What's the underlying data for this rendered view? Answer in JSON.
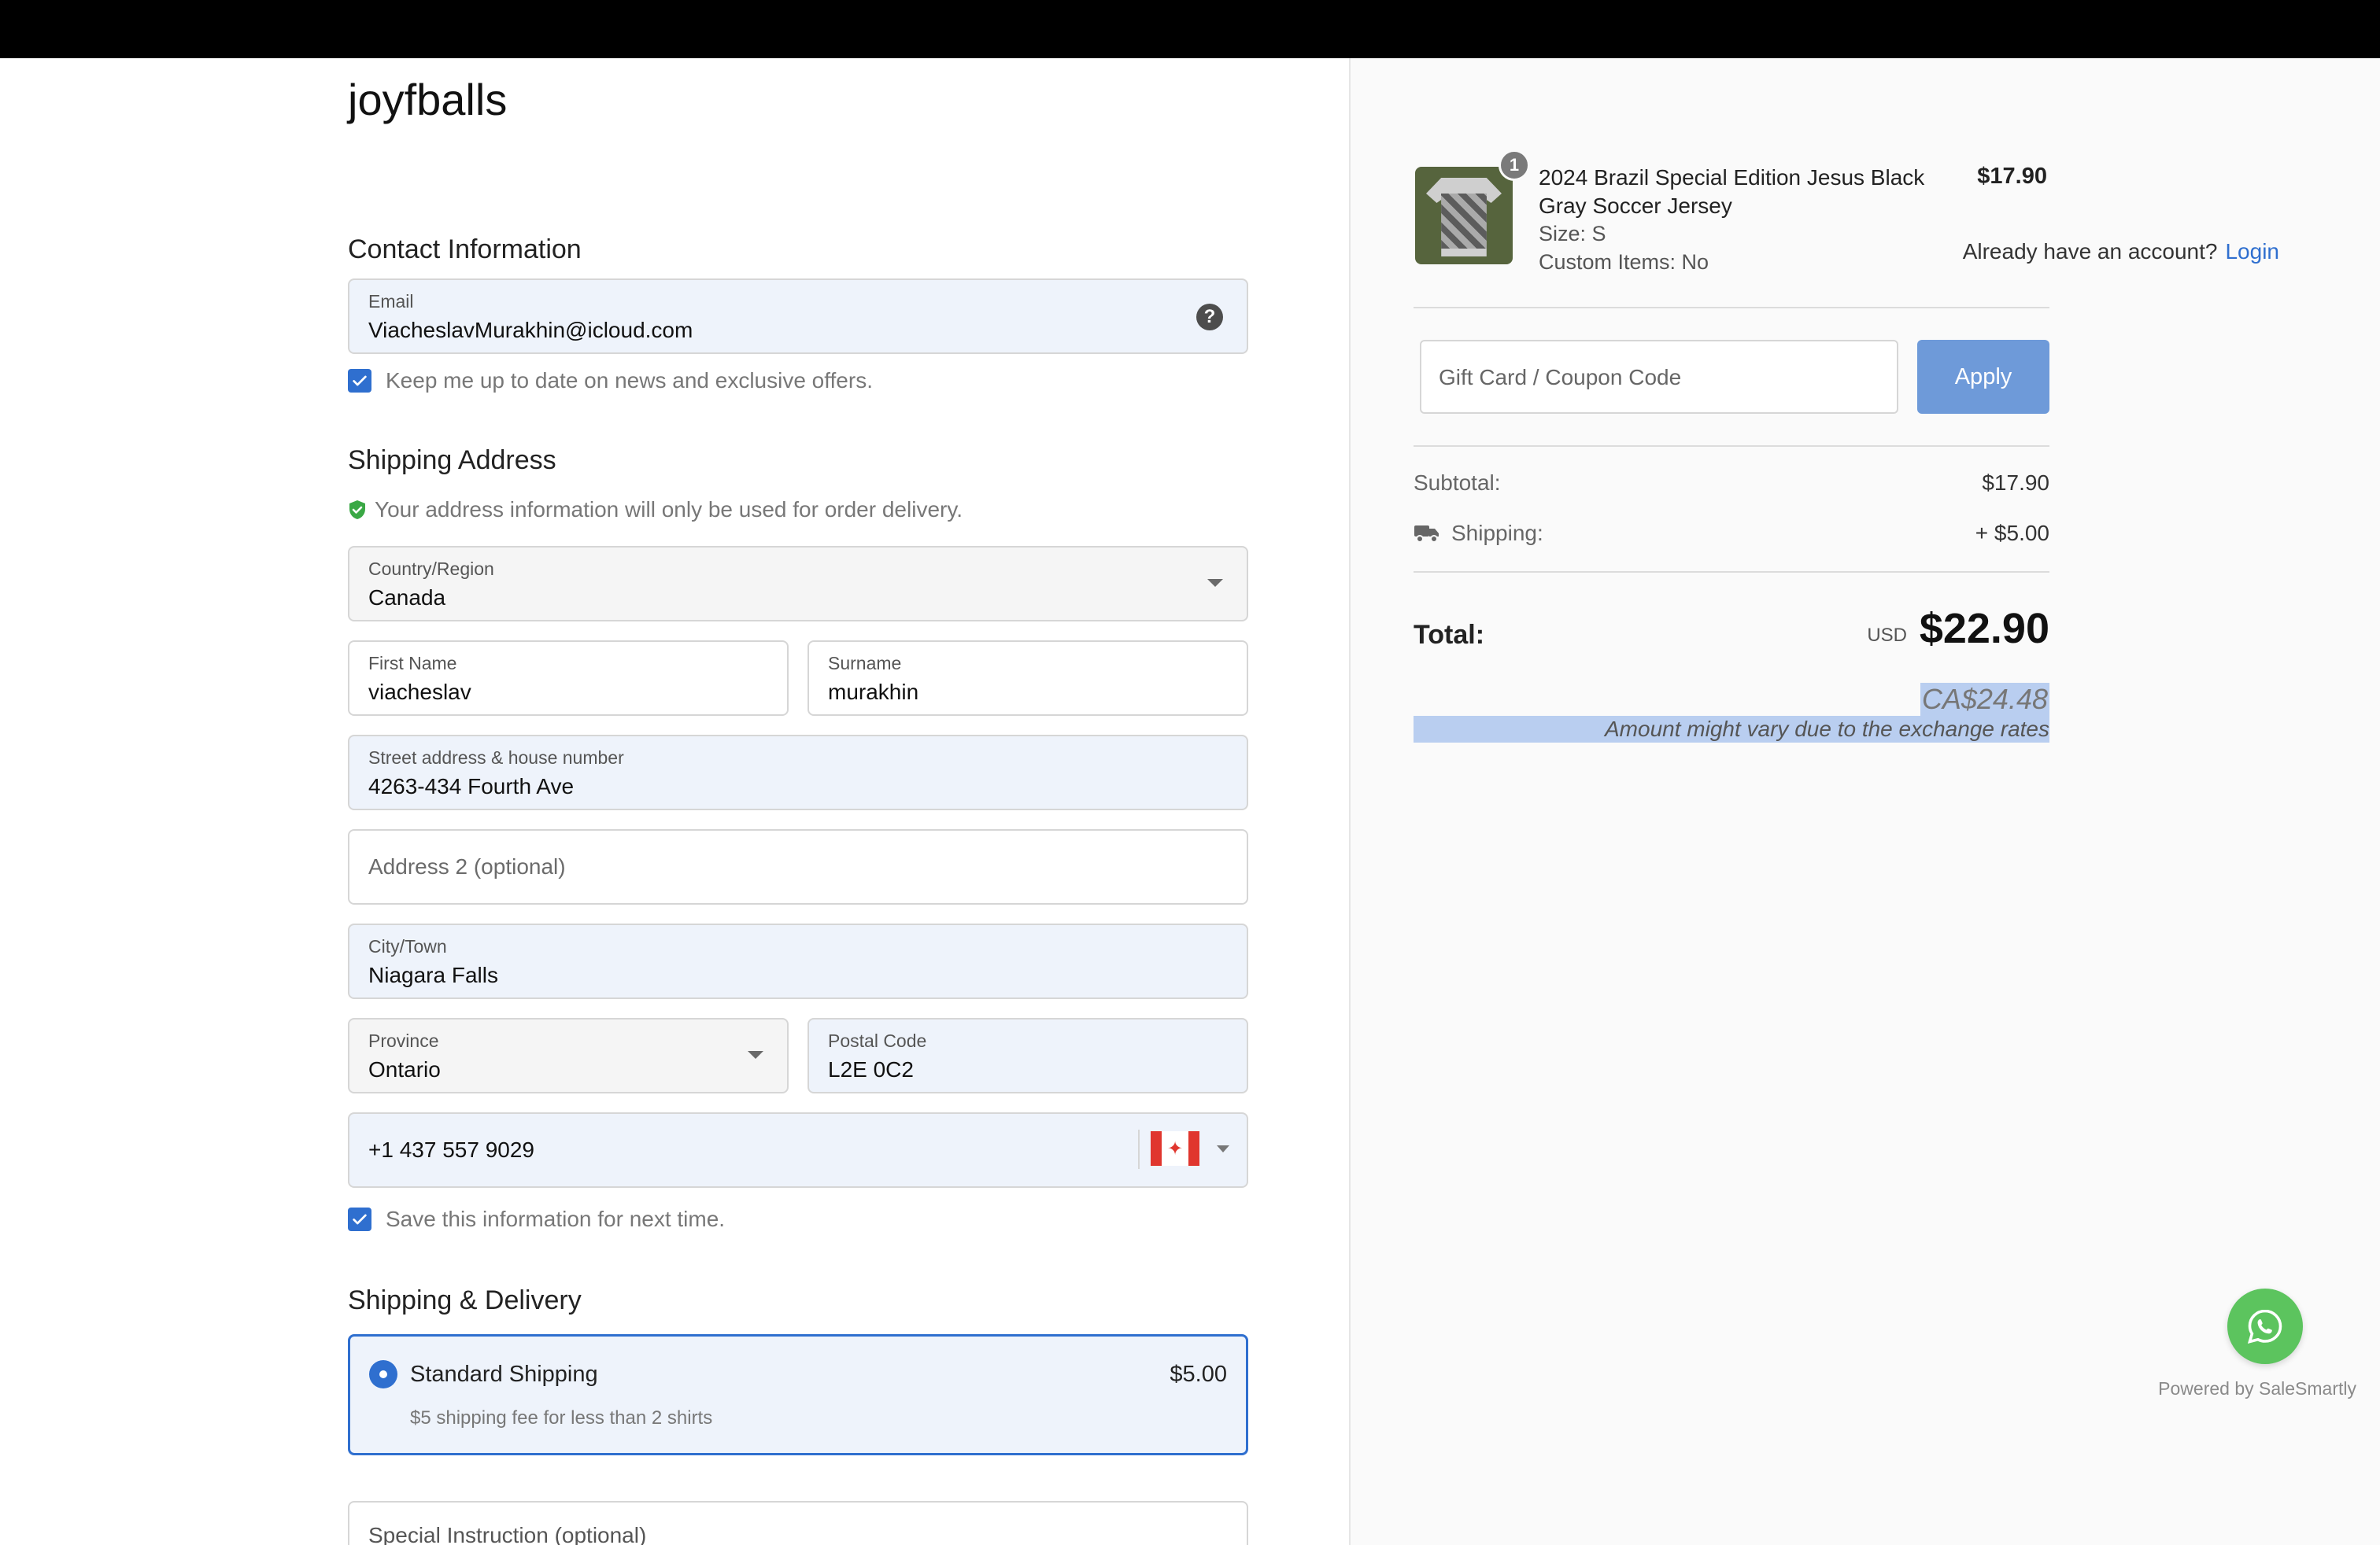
{
  "brand": "joyfballs",
  "contact": {
    "title": "Contact Information",
    "account_prompt": "Already have an account?",
    "login_link": "Login",
    "email_label": "Email",
    "email_value": "ViacheslavMurakhin@icloud.com",
    "newsletter_label": "Keep me up to date on news and exclusive offers.",
    "newsletter_checked": true
  },
  "shipping_address": {
    "title": "Shipping Address",
    "privacy_note": "Your address information will only be used for order delivery.",
    "country_label": "Country/Region",
    "country_value": "Canada",
    "first_name_label": "First Name",
    "first_name_value": "viacheslav",
    "surname_label": "Surname",
    "surname_value": "murakhin",
    "street_label": "Street address & house number",
    "street_value": "4263-434 Fourth Ave",
    "address2_placeholder": "Address 2 (optional)",
    "city_label": "City/Town",
    "city_value": "Niagara Falls",
    "province_label": "Province",
    "province_value": "Ontario",
    "postal_label": "Postal Code",
    "postal_value": "L2E 0C2",
    "phone_value": "+1 437 557 9029",
    "phone_flag": "canada-flag-icon",
    "save_info_label": "Save this information for next time.",
    "save_info_checked": true
  },
  "delivery": {
    "title": "Shipping & Delivery",
    "option_name": "Standard Shipping",
    "option_price": "$5.00",
    "option_desc": "$5 shipping fee for less than 2 shirts",
    "special_instruction_placeholder": "Special Instruction (optional)"
  },
  "cart": {
    "quantity": "1",
    "product_title": "2024 Brazil Special Edition Jesus Black Gray Soccer Jersey",
    "size": "Size: S",
    "custom_items": "Custom Items: No",
    "price": "$17.90"
  },
  "coupon": {
    "placeholder": "Gift Card / Coupon Code",
    "apply_label": "Apply"
  },
  "summary": {
    "subtotal_label": "Subtotal:",
    "subtotal_value": "$17.90",
    "shipping_label": "Shipping:",
    "shipping_value": "+ $5.00",
    "total_label": "Total:",
    "currency": "USD",
    "total_value": "$22.90",
    "converted_value": "CA$24.48",
    "exchange_note": "Amount might vary due to the exchange rates"
  },
  "widget": {
    "powered_by": "Powered by SaleSmartly"
  },
  "colors": {
    "accent": "#2f6fcf",
    "apply_button": "#6e9ad9",
    "whatsapp": "#5cc45e",
    "shield": "#3aa845"
  }
}
